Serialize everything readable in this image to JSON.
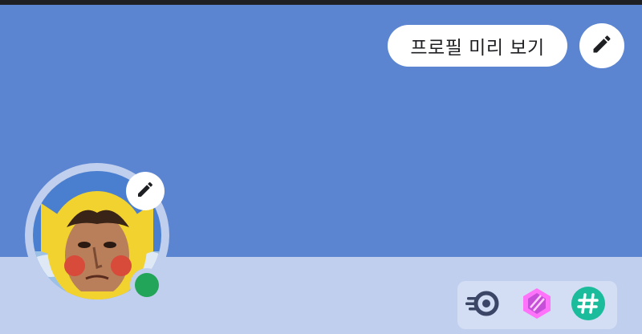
{
  "profile_header": {
    "preview_button_label": "프로필 미리 보기",
    "banner_color": "#5b85d1",
    "lower_panel_color": "#c1cfee"
  },
  "avatar": {
    "status": "online",
    "status_color": "#23a559",
    "edit_icon": "pencil-icon"
  },
  "banner_edit": {
    "icon": "pencil-icon"
  },
  "badges": [
    {
      "icon": "nitro-speed-icon",
      "color": "#3b4666"
    },
    {
      "icon": "boost-gem-icon",
      "color": "#ff73fa"
    },
    {
      "icon": "hashtag-icon",
      "color": "#1abc9c"
    }
  ]
}
